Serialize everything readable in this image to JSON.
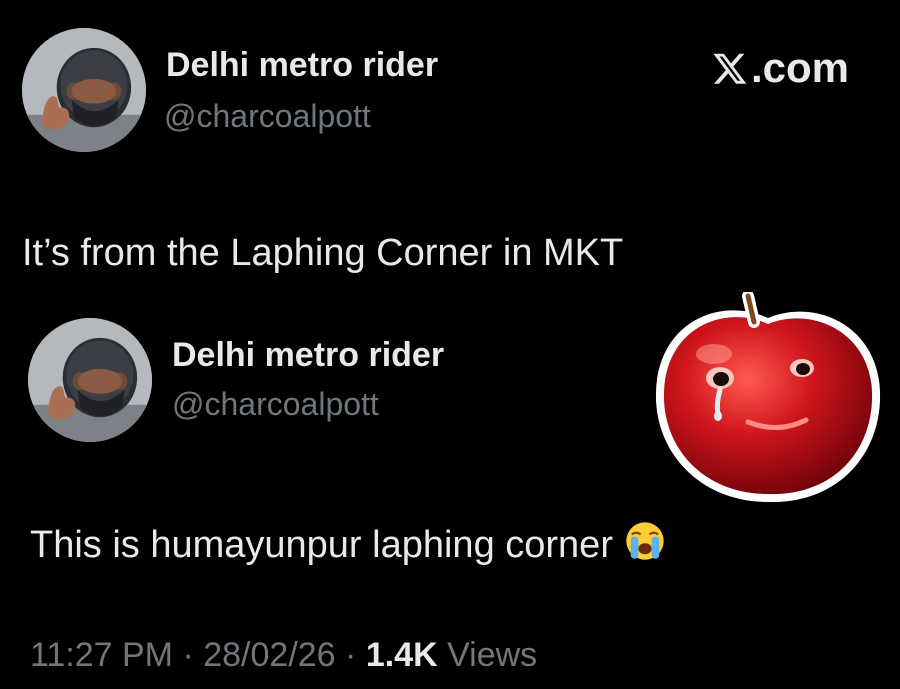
{
  "quoted_tweet": {
    "display_name": "Delhi metro rider",
    "handle": "@charcoalpott",
    "text": "It’s from the Laphing Corner in MKT"
  },
  "brand": {
    "label": ".com",
    "icon": "x-logo-icon"
  },
  "reply_tweet": {
    "display_name": "Delhi metro rider",
    "handle": "@charcoalpott",
    "text": "This is humayunpur laphing corner",
    "emoji_icon": "loudly-crying-face-icon",
    "sticker_icon": "crying-apple-sticker-icon",
    "time": "11:27 PM",
    "separator": " · ",
    "date": "28/02/26",
    "views_count": "1.4K",
    "views_label": "Views"
  },
  "colors": {
    "background": "#000000",
    "primary_text": "#e7e9ea",
    "secondary_text": "#71767b",
    "apple_red": "#c8101a"
  }
}
